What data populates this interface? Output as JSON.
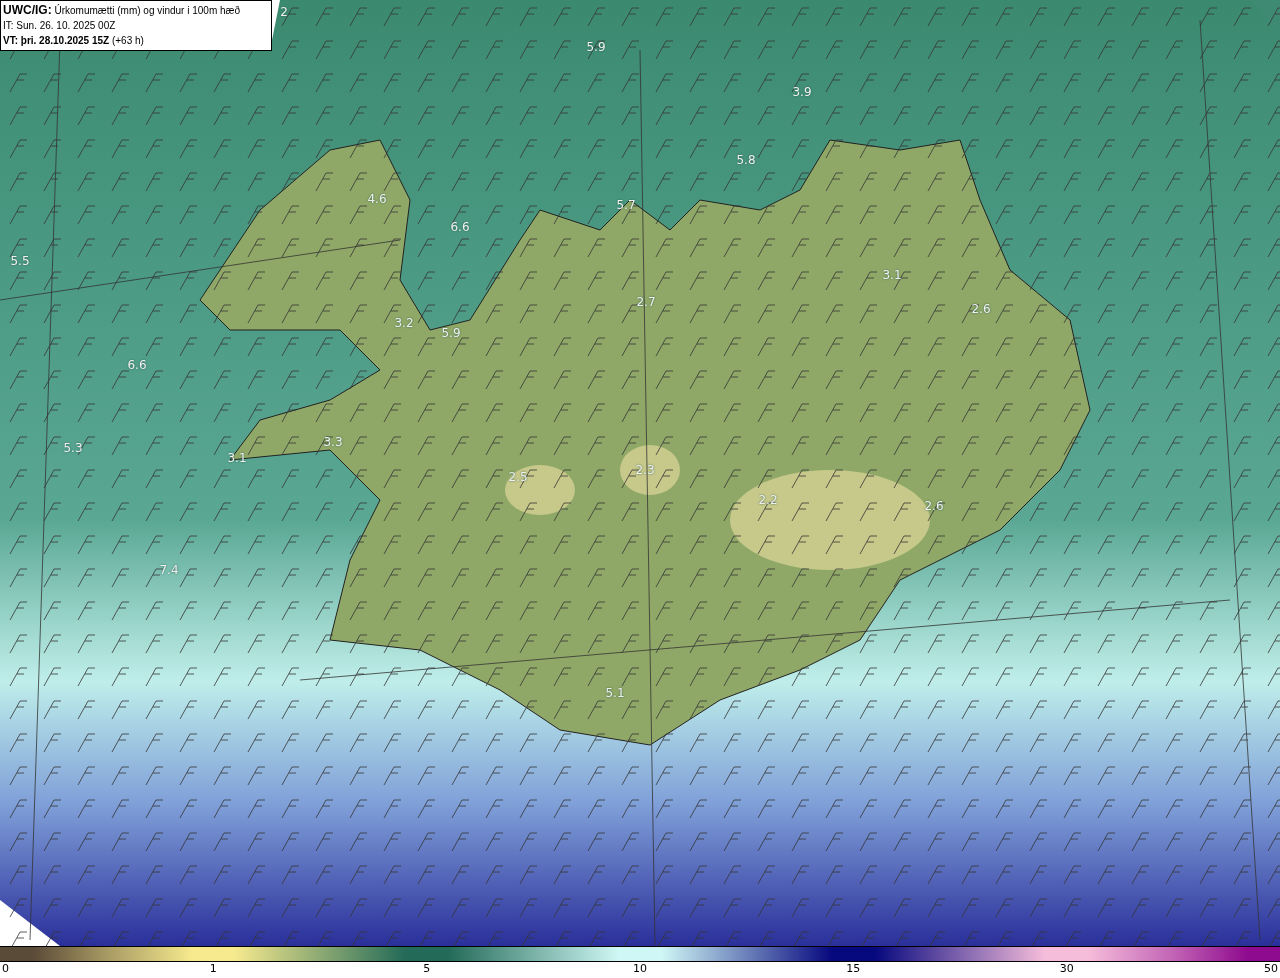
{
  "header": {
    "product": "UWC/IG:",
    "title": "Úrkomumætti (mm) og vindur i 100m hæð",
    "initial_time": "IT: Sun. 26. 10. 2025 00Z",
    "valid_label": "VT: þri. 28.10.2025 15Z",
    "valid_offset": "(+63 h)"
  },
  "map_labels": [
    "2",
    "5.9",
    "3.9",
    "5.8",
    "5.7",
    "4.6",
    "6.6",
    "5.5",
    "3.1",
    "2.6",
    "3.2",
    "5.9",
    "2.7",
    "6.6",
    "5.3",
    "3.3",
    "3.1",
    "2.5",
    "2.3",
    "2.2",
    "2.6",
    "7.4",
    "5.1"
  ],
  "legend": {
    "stops": [
      {
        "label": "0",
        "color": "#5a4a38"
      },
      {
        "label": "1",
        "color": "#f6e98e"
      },
      {
        "label": "5",
        "color": "#236a58"
      },
      {
        "label": "10",
        "color": "#cff7f5"
      },
      {
        "label": "15",
        "color": "#06087e"
      },
      {
        "label": "30",
        "color": "#f6bddb"
      },
      {
        "label": "50",
        "color": "#8e0a8e"
      }
    ]
  }
}
